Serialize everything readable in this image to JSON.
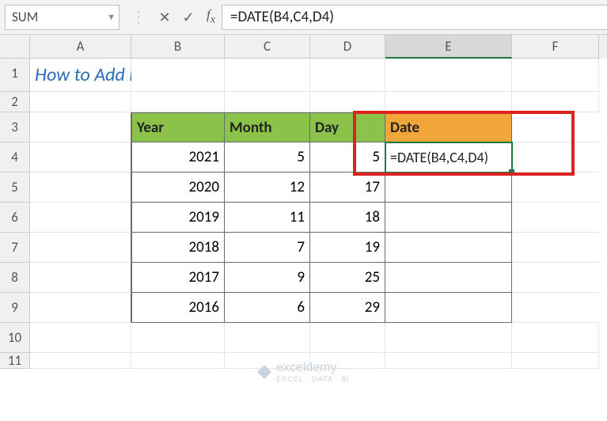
{
  "formula_bar": {
    "name_box": "SUM",
    "formula": "=DATE(B4,C4,D4)"
  },
  "columns": [
    "A",
    "B",
    "C",
    "D",
    "E",
    "F"
  ],
  "row_numbers": [
    "1",
    "2",
    "3",
    "4",
    "5",
    "6",
    "7",
    "8",
    "9",
    "10",
    "11"
  ],
  "title": "How to Add Days to Date Using DATE Function",
  "table": {
    "headers": {
      "year": "Year",
      "month": "Month",
      "day": "Day",
      "date": "Date"
    },
    "rows": [
      {
        "year": "2021",
        "month": "5",
        "day": "5",
        "date": "=DATE(B4,C4,D4)"
      },
      {
        "year": "2020",
        "month": "12",
        "day": "17",
        "date": ""
      },
      {
        "year": "2019",
        "month": "11",
        "day": "18",
        "date": ""
      },
      {
        "year": "2018",
        "month": "7",
        "day": "19",
        "date": ""
      },
      {
        "year": "2017",
        "month": "9",
        "day": "25",
        "date": ""
      },
      {
        "year": "2016",
        "month": "6",
        "day": "29",
        "date": ""
      }
    ]
  },
  "watermark": {
    "brand": "exceldemy",
    "tagline": "EXCEL · DATA · BI"
  },
  "chart_data": {
    "type": "table",
    "title": "How to Add Days to Date Using DATE Function",
    "columns": [
      "Year",
      "Month",
      "Day",
      "Date"
    ],
    "rows": [
      [
        2021,
        5,
        5,
        "=DATE(B4,C4,D4)"
      ],
      [
        2020,
        12,
        17,
        null
      ],
      [
        2019,
        11,
        18,
        null
      ],
      [
        2018,
        7,
        19,
        null
      ],
      [
        2017,
        9,
        25,
        null
      ],
      [
        2016,
        6,
        29,
        null
      ]
    ]
  }
}
